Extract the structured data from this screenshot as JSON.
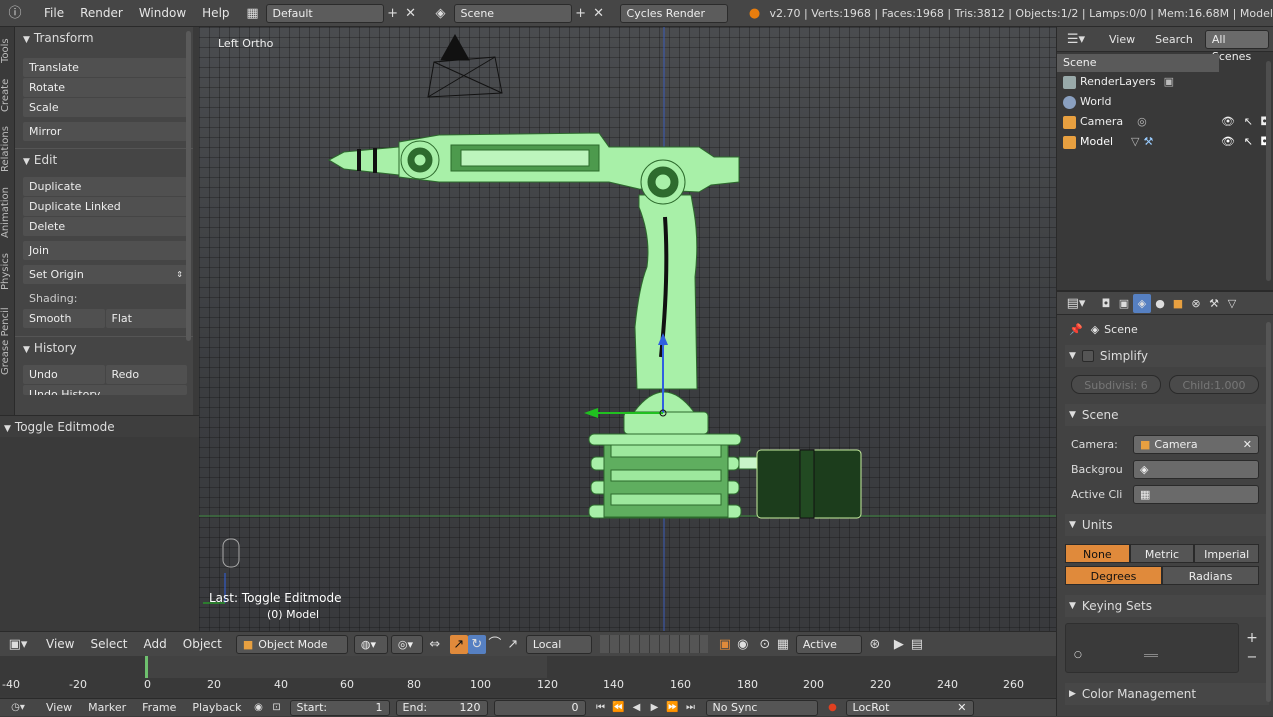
{
  "topbar": {
    "menus": [
      "File",
      "Render",
      "Window",
      "Help"
    ],
    "layout": "Default",
    "scene": "Scene",
    "engine": "Cycles Render",
    "stats": "v2.70 | Verts:1968 | Faces:1968 | Tris:3812 | Objects:1/2 | Lamps:0/0 | Mem:16.68M | Model"
  },
  "tool_tabs": [
    "Tools",
    "Create",
    "Relations",
    "Animation",
    "Physics",
    "Grease Pencil"
  ],
  "toolshelf": {
    "transform_header": "Transform",
    "translate": "Translate",
    "rotate": "Rotate",
    "scale": "Scale",
    "mirror": "Mirror",
    "edit_header": "Edit",
    "duplicate": "Duplicate",
    "duplicate_linked": "Duplicate Linked",
    "delete": "Delete",
    "join": "Join",
    "set_origin": "Set Origin",
    "shading_label": "Shading:",
    "smooth": "Smooth",
    "flat": "Flat",
    "history_header": "History",
    "undo": "Undo",
    "redo": "Redo",
    "undo_history": "Undo History"
  },
  "redo_panel": {
    "title": "Toggle Editmode"
  },
  "viewport": {
    "view_name": "Left Ortho",
    "last_op": "Last: Toggle Editmode",
    "object_label": "(0) Model"
  },
  "view_header": {
    "menus": [
      "View",
      "Select",
      "Add",
      "Object"
    ],
    "mode": "Object Mode",
    "orientation": "Local",
    "pivot": "Active"
  },
  "timeline": {
    "ticks": [
      "-40",
      "-20",
      "0",
      "20",
      "40",
      "60",
      "80",
      "100",
      "120",
      "140",
      "160",
      "180",
      "200",
      "220",
      "240",
      "260"
    ],
    "menus": [
      "View",
      "Marker",
      "Frame",
      "Playback"
    ],
    "start_label": "Start:",
    "start_value": "1",
    "end_label": "End:",
    "end_value": "120",
    "current_frame": "0",
    "sync": "No Sync",
    "keying": "LocRot"
  },
  "outliner": {
    "tabs": [
      "View",
      "Search",
      "All Scenes"
    ],
    "scene_label": "Scene",
    "items": [
      "RenderLayers",
      "World",
      "Camera",
      "Model"
    ]
  },
  "properties": {
    "context": "Scene",
    "simplify": "Simplify",
    "subdivision": "Subdivisi: 6",
    "child": "Child:1.000",
    "scene_header": "Scene",
    "camera_label": "Camera:",
    "camera_value": "Camera",
    "background_label": "Backgrou",
    "active_clip_label": "Active Cli",
    "units_header": "Units",
    "unit_systems": [
      "None",
      "Metric",
      "Imperial"
    ],
    "rotation_units": [
      "Degrees",
      "Radians"
    ],
    "keying_sets_header": "Keying Sets",
    "color_management_header": "Color Management"
  },
  "colors": {
    "accent": "#e08a3b",
    "selection": "#5680c2",
    "mesh": "#a8f0a8",
    "mesh_edge": "#2c6a2c"
  }
}
